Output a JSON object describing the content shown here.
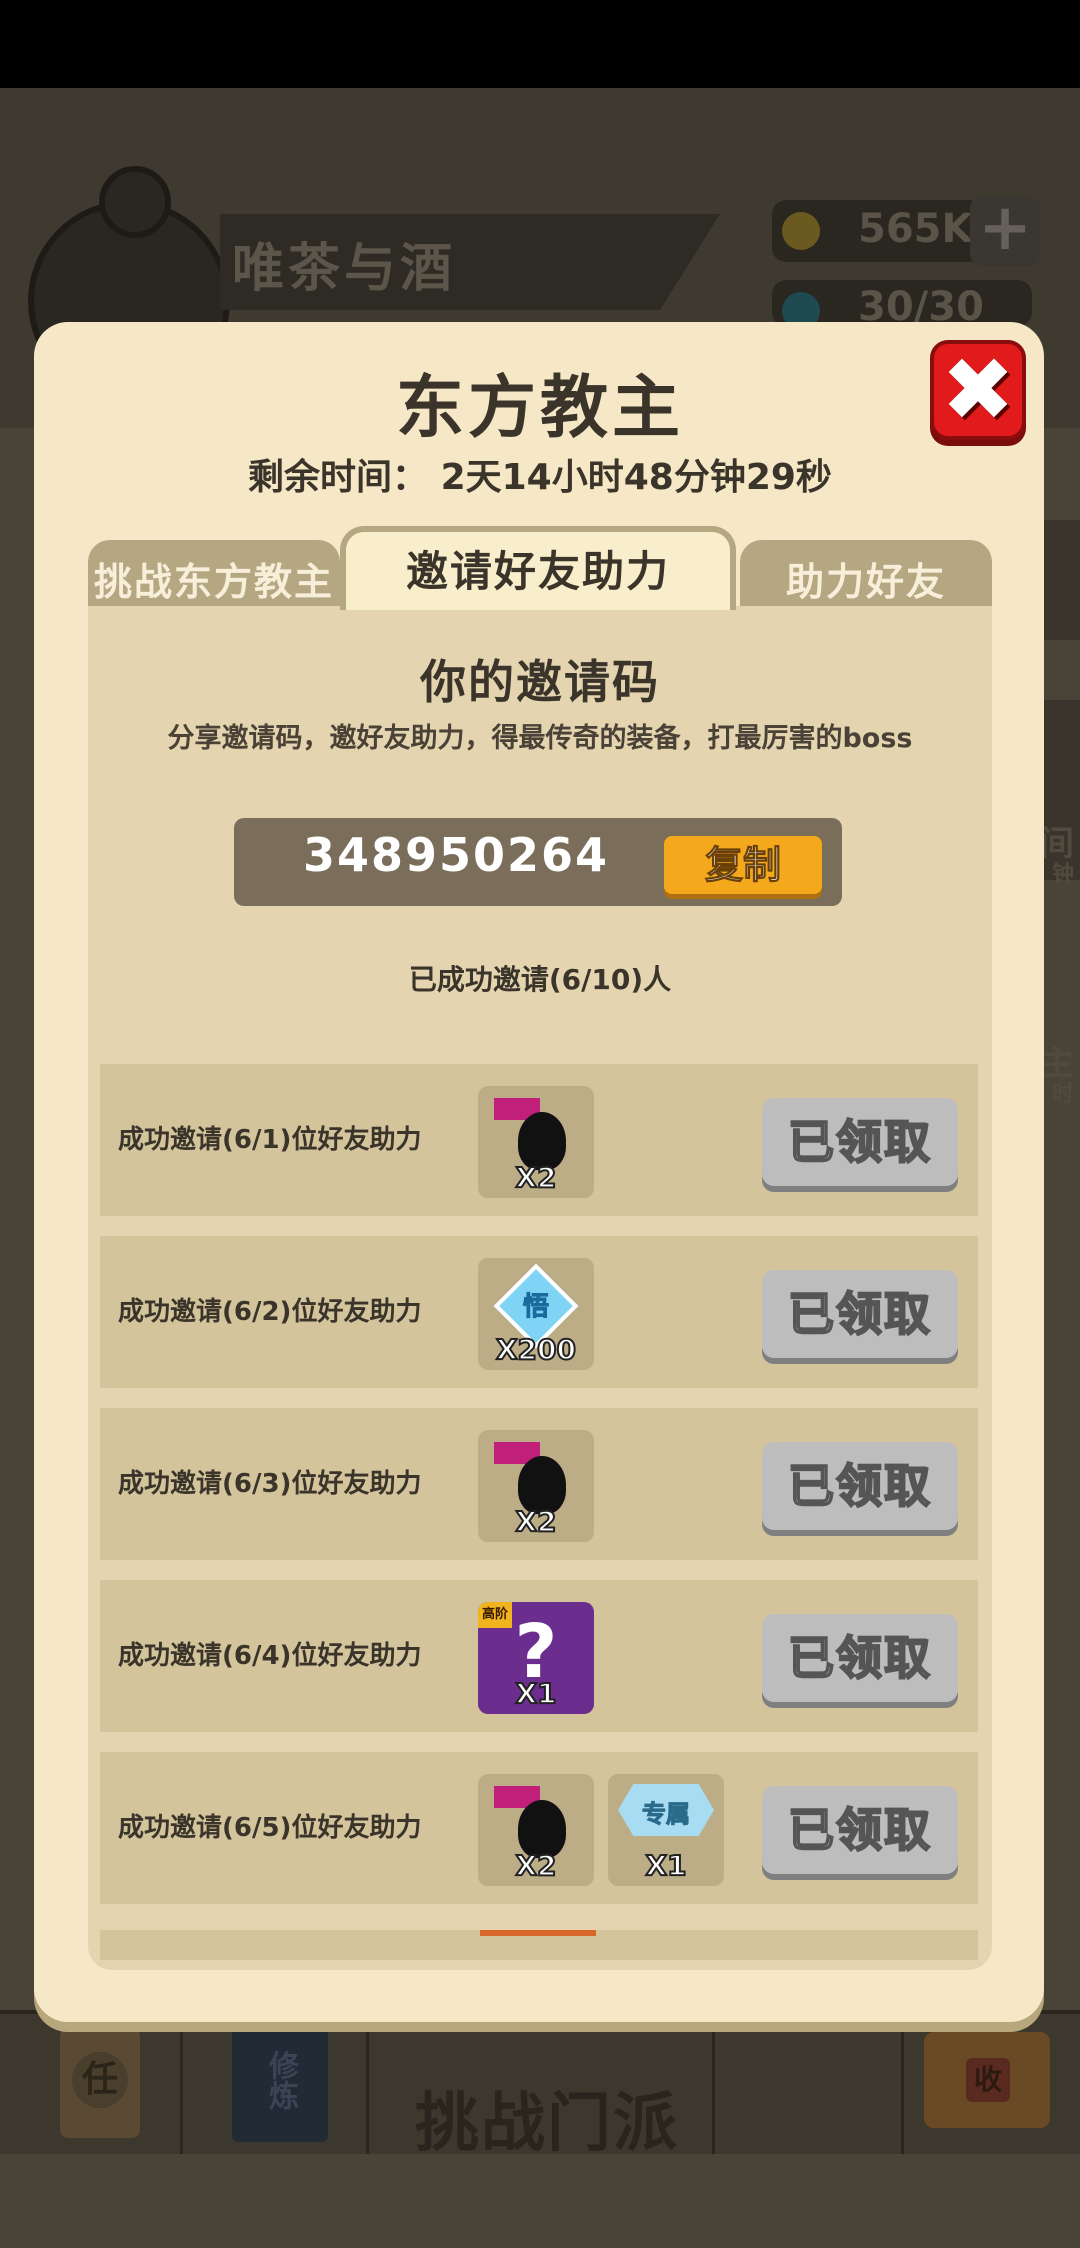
{
  "background": {
    "player_name": "唯茶与酒",
    "coins": "565K",
    "energy": "30/30",
    "side_labels": [
      "间",
      "钟",
      "主",
      "时"
    ],
    "bottom_nav": {
      "task_char": "任",
      "cultivate_label": "修炼",
      "challenge_label": "挑战门派",
      "chest_char": "收"
    }
  },
  "modal": {
    "title": "东方教主",
    "remaining_time": "剩余时间：  2天14小时48分钟29秒",
    "close_symbol": "✖",
    "tabs": [
      {
        "label": "挑战东方教主"
      },
      {
        "label": "邀请好友助力"
      },
      {
        "label": "助力好友"
      }
    ],
    "active_tab_index": 1,
    "invite": {
      "heading": "你的邀请码",
      "description": "分享邀请码，邀好友助力，得最传奇的装备，打最厉害的boss",
      "code": "348950264",
      "copy_label": "复制",
      "progress_text": "已成功邀请(6/10)人"
    },
    "rewards": [
      {
        "label": "成功邀请(6/1)位好友助力",
        "items": [
          {
            "icon": "warrior-silhouette-icon",
            "qty": "X2"
          }
        ],
        "button": "已领取"
      },
      {
        "label": "成功邀请(6/2)位好友助力",
        "items": [
          {
            "icon": "enlightenment-diamond-icon",
            "char": "悟",
            "qty": "X200"
          }
        ],
        "button": "已领取"
      },
      {
        "label": "成功邀请(6/3)位好友助力",
        "items": [
          {
            "icon": "warrior-silhouette-icon",
            "qty": "X2"
          }
        ],
        "button": "已领取"
      },
      {
        "label": "成功邀请(6/4)位好友助力",
        "items": [
          {
            "icon": "mystery-box-icon",
            "tag": "高阶",
            "mark": "?",
            "qty": "X1"
          }
        ],
        "button": "已领取"
      },
      {
        "label": "成功邀请(6/5)位好友助力",
        "items": [
          {
            "icon": "warrior-silhouette-icon",
            "qty": "X2"
          },
          {
            "icon": "exclusive-plate-icon",
            "char": "专属",
            "qty": "X1"
          }
        ],
        "button": "已领取"
      }
    ]
  }
}
